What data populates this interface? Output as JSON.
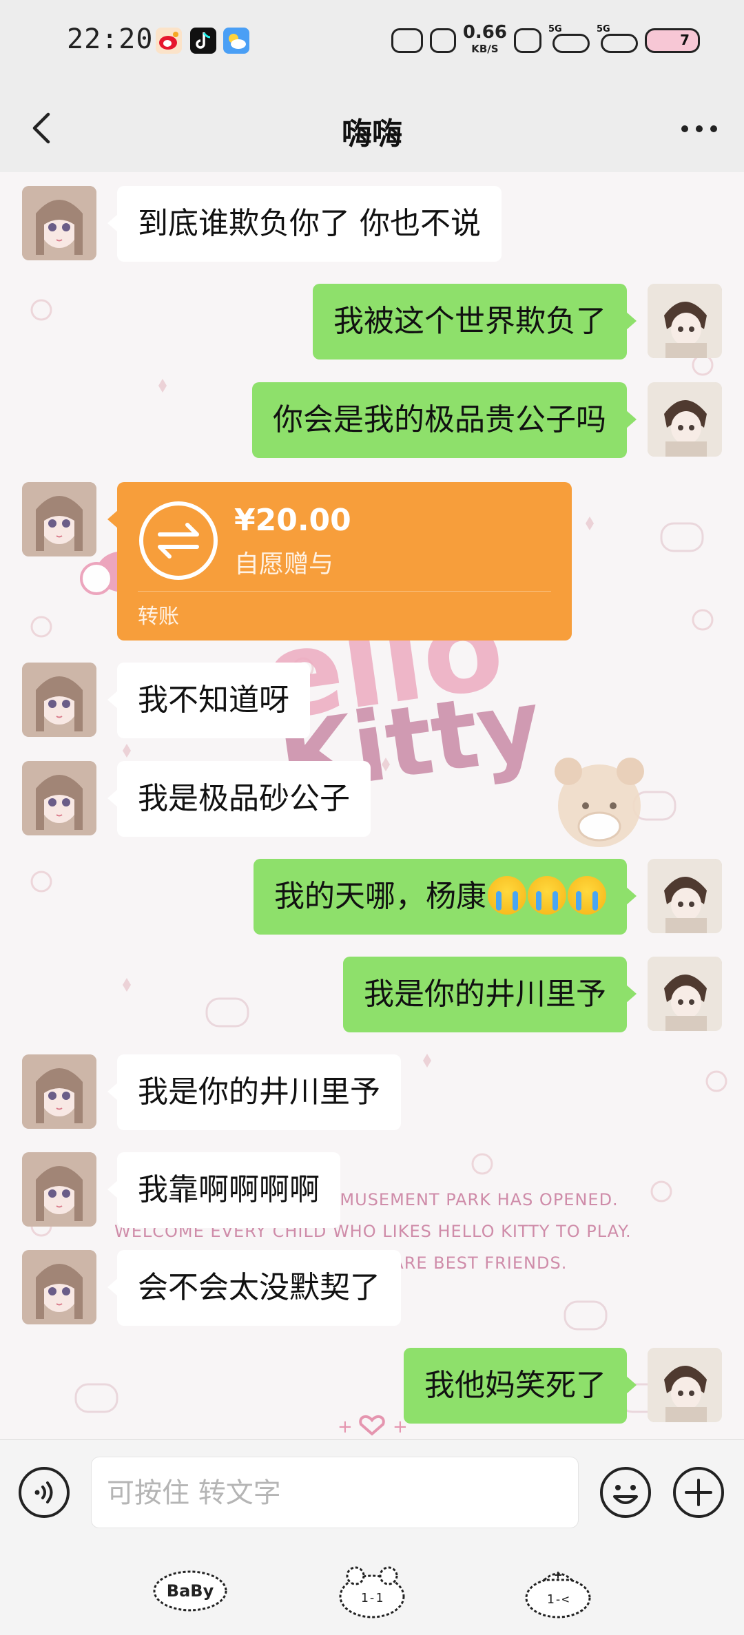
{
  "status_bar": {
    "time": "22:20",
    "net_speed_value": "0.66",
    "net_speed_unit": "KB/S",
    "signal_1": "5G",
    "signal_2": "5G",
    "battery": "7"
  },
  "header": {
    "title": "嗨嗨"
  },
  "messages": [
    {
      "side": "in",
      "text": "到底谁欺负你了 你也不说"
    },
    {
      "side": "out",
      "text": "我被这个世界欺负了"
    },
    {
      "side": "out",
      "text": "你会是我的极品贵公子吗"
    },
    {
      "side": "in",
      "type": "transfer",
      "amount": "¥20.00",
      "note": "自愿赠与",
      "label": "转账"
    },
    {
      "side": "in",
      "text": "我不知道呀"
    },
    {
      "side": "in",
      "text": "我是极品砂公子"
    },
    {
      "side": "out",
      "text": "我的天哪，杨康",
      "emoji": "loudly-crying-face",
      "emoji_count": 3
    },
    {
      "side": "out",
      "text": "我是你的井川里予"
    },
    {
      "side": "in",
      "text": "我是你的井川里予"
    },
    {
      "side": "in",
      "text": "我靠啊啊啊啊"
    },
    {
      "side": "in",
      "text": "会不会太没默契了"
    },
    {
      "side": "out",
      "text": "我他妈笑死了"
    }
  ],
  "wallpaper": {
    "line_1": "AMUSEMENT PARK HAS OPENED.",
    "line_2": "WELCOME EVERY CHILD WHO LIKES HELLO KITTY TO PLAY.",
    "line_3": "EN WE ARE BEST FRIENDS.",
    "logo_text": "Hello Kitty"
  },
  "input_bar": {
    "placeholder": "可按住 转文字"
  },
  "bottom_bar": {
    "deco_1": "BaBy",
    "deco_2": "1-1",
    "deco_3": "1-<"
  },
  "colors": {
    "outgoing_bubble": "#8ee06b",
    "incoming_bubble": "#ffffff",
    "transfer_card": "#f79e3b",
    "header_bg": "#ededed"
  }
}
